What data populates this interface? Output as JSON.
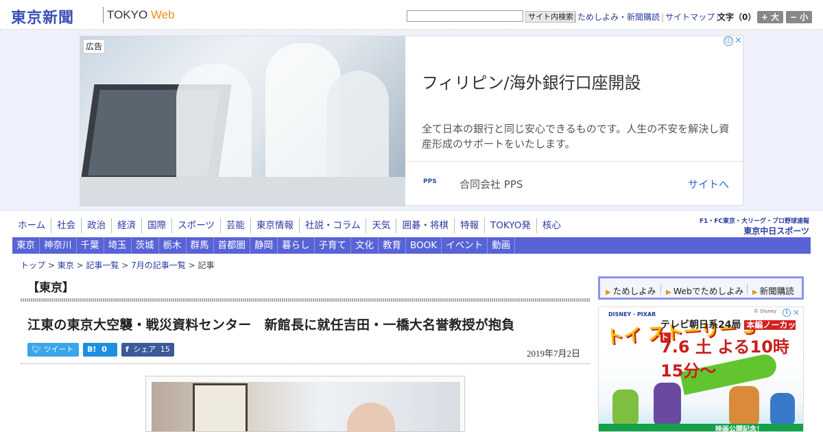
{
  "header": {
    "logo": "東京新聞",
    "logo_sub": "TOKYO",
    "logo_web": "Web",
    "search_button": "サイト内検索",
    "links": [
      "ためしよみ・新聞購読",
      "サイトマップ"
    ],
    "font_size_label": "文字（0）",
    "font_bigger": "+ 大",
    "font_smaller": "− 小"
  },
  "ad": {
    "badge": "広告",
    "title": "フィリピン/海外銀行口座開設",
    "description": "全て日本の銀行と同じ安心できるものです。人生の不安を解決し資産形成のサポートをいたします。",
    "brand_logo": "PPS",
    "brand": "合同会社 PPS",
    "cta": "サイトへ",
    "info_icon": "ⓘ",
    "close_icon": "✕"
  },
  "nav_main": [
    "ホーム",
    "社会",
    "政治",
    "経済",
    "国際",
    "スポーツ",
    "芸能",
    "東京情報",
    "社説・コラム",
    "天気",
    "囲碁・将棋",
    "特報",
    "TOKYO発",
    "核心"
  ],
  "chunichi": {
    "top": "F1・FC東京・大リーグ・プロ野球速報",
    "bottom": "東京中日スポーツ"
  },
  "nav_region": [
    "東京",
    "神奈川",
    "千葉",
    "埼玉",
    "茨城",
    "栃木",
    "群馬",
    "首都圏",
    "静岡",
    "暮らし",
    "子育て",
    "文化",
    "教育",
    "BOOK",
    "イベント",
    "動画"
  ],
  "breadcrumb": {
    "items": [
      "トップ",
      "東京",
      "記事一覧",
      "7月の記事一覧",
      "記事"
    ],
    "separator": " > "
  },
  "article": {
    "section": "【東京】",
    "title": "江東の東京大空襲・戦災資料センター　新館長に就任吉田・一橋大名誉教授が抱負",
    "date": "2019年7月2日",
    "share": {
      "tweet": "ツイート",
      "hatena": "B!",
      "hatena_count": "0",
      "facebook": "シェア",
      "facebook_count": "15"
    }
  },
  "sidebar": {
    "links": [
      "ためしよみ",
      "Webでためしよみ",
      "新聞購読"
    ],
    "ad": {
      "disney": "DISNEY · PIXAR",
      "movie_title": "トイ ストーリー 3",
      "tv": "テレビ朝日系24局",
      "tv_badge": "本編ノーカット",
      "date_text": "7.6 土 よる10時15分～",
      "bottom_text": "映画公開記念！",
      "brand": "© Disney"
    }
  },
  "colors": {
    "brand_blue": "#3a4fb8",
    "nav_bar": "#5863d6",
    "web_orange": "#e8921e"
  }
}
